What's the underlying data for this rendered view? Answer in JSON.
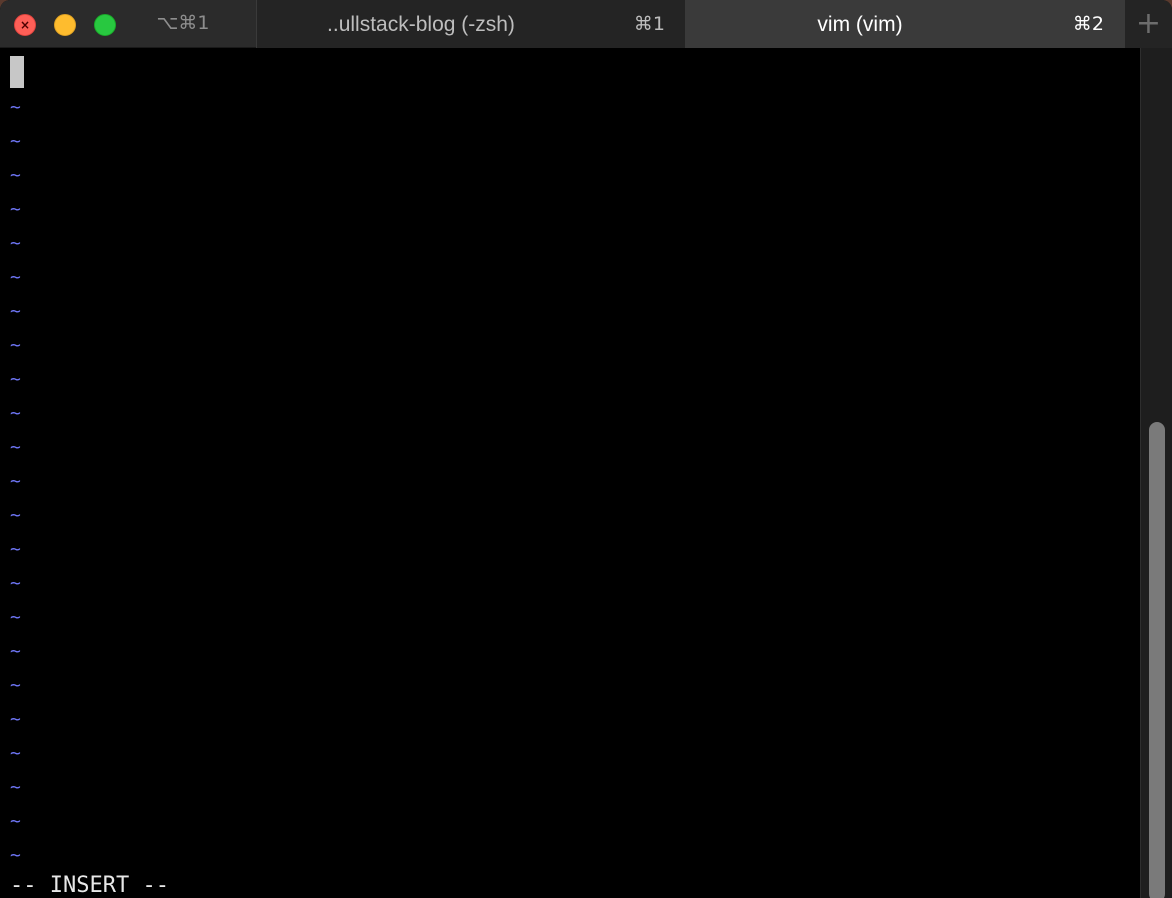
{
  "window": {
    "shortcut": "⌥⌘1",
    "close_glyph": "×"
  },
  "tabs": [
    {
      "title": "..ullstack-blog (-zsh)",
      "shortcut": "⌘1",
      "active": false
    },
    {
      "title": "vim (vim)",
      "shortcut": "⌘2",
      "active": true
    }
  ],
  "new_tab": {
    "label": "+"
  },
  "editor": {
    "empty_line_marker": "~",
    "empty_line_count": 23,
    "mode": "-- INSERT --"
  },
  "colors": {
    "tilde": "#6f76f7",
    "background": "#000000",
    "cursor": "#c7c7c7"
  }
}
